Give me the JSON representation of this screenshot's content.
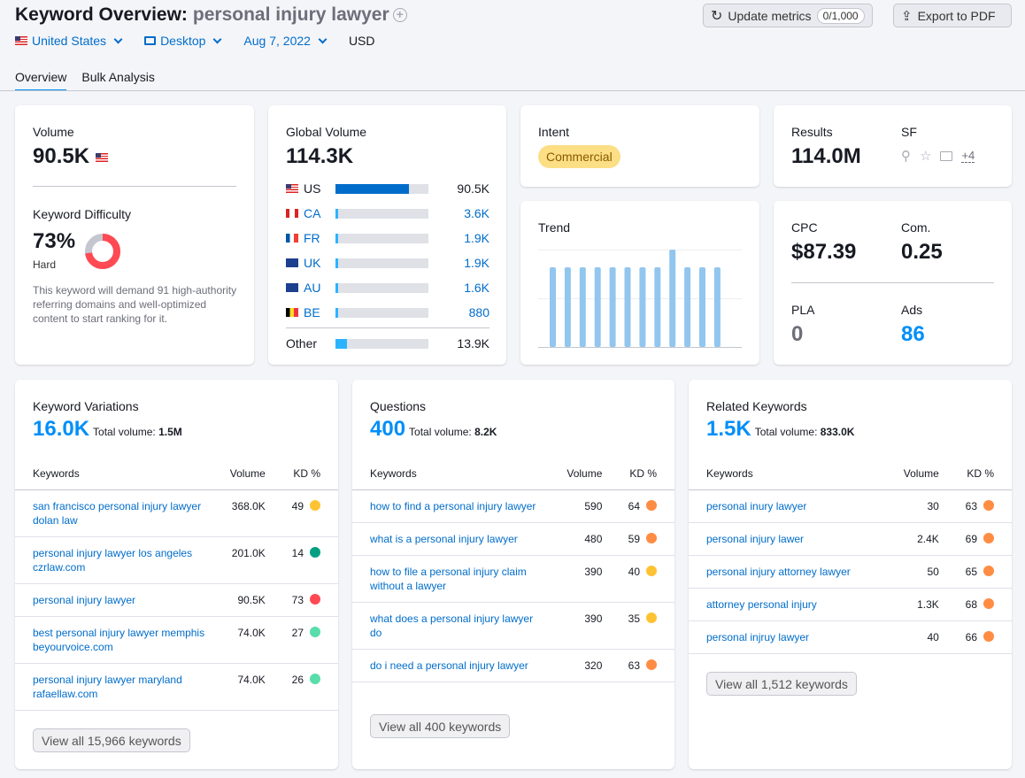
{
  "header": {
    "title": "Keyword Overview:",
    "keyword": "personal injury lawyer",
    "add_icon": "plus-circle-icon",
    "country": "United States",
    "device": "Desktop",
    "date": "Aug 7, 2022",
    "currency": "USD",
    "update_label": "Update metrics",
    "update_count": "0/1,000",
    "export_label": "Export to PDF"
  },
  "tabs": [
    {
      "label": "Overview",
      "active": true
    },
    {
      "label": "Bulk Analysis",
      "active": false
    }
  ],
  "volume": {
    "label": "Volume",
    "value": "90.5K"
  },
  "kd": {
    "label": "Keyword Difficulty",
    "value": "73%",
    "percent": 73,
    "level": "Hard",
    "description": "This keyword will demand 91 high-authority referring domains and well-optimized content to start ranking for it.",
    "color": "#ff4953"
  },
  "global_volume": {
    "label": "Global Volume",
    "value": "114.3K",
    "countries": [
      {
        "code": "US",
        "value": "90.5K",
        "share": 0.79
      },
      {
        "code": "CA",
        "value": "3.6K",
        "share": 0.03
      },
      {
        "code": "FR",
        "value": "1.9K",
        "share": 0.017
      },
      {
        "code": "UK",
        "value": "1.9K",
        "share": 0.017
      },
      {
        "code": "AU",
        "value": "1.6K",
        "share": 0.014
      },
      {
        "code": "BE",
        "value": "880",
        "share": 0.008
      }
    ],
    "other": {
      "label": "Other",
      "value": "13.9K",
      "share": 0.12
    }
  },
  "intent": {
    "label": "Intent",
    "value": "Commercial"
  },
  "results": {
    "label": "Results",
    "value": "114.0M",
    "sf_label": "SF",
    "sf_more": "+4",
    "sf_icons": [
      "location-pin-icon",
      "star-icon",
      "image-icon"
    ]
  },
  "trend": {
    "label": "Trend",
    "values": [
      74000,
      74000,
      74000,
      74000,
      74000,
      74000,
      74000,
      74000,
      90500,
      74000,
      74000,
      74000
    ]
  },
  "cpc": {
    "label": "CPC",
    "value": "$87.39"
  },
  "com": {
    "label": "Com.",
    "value": "0.25"
  },
  "pla": {
    "label": "PLA",
    "value": "0"
  },
  "ads": {
    "label": "Ads",
    "value": "86"
  },
  "panels": [
    {
      "title": "Keyword Variations",
      "count": "16.0K",
      "total_label": "Total volume:",
      "total": "1.5M",
      "cols": [
        "Keywords",
        "Volume",
        "KD %"
      ],
      "rows": [
        {
          "k": "san francisco personal injury lawyer dolan law",
          "v": "368.0K",
          "kd": "49",
          "c": "#ffc233"
        },
        {
          "k": "personal injury lawyer los angeles czrlaw.com",
          "v": "201.0K",
          "kd": "14",
          "c": "#009f81"
        },
        {
          "k": "personal injury lawyer",
          "v": "90.5K",
          "kd": "73",
          "c": "#ff4953"
        },
        {
          "k": "best personal injury lawyer memphis beyourvoice.com",
          "v": "74.0K",
          "kd": "27",
          "c": "#59ddaa"
        },
        {
          "k": "personal injury lawyer maryland rafaellaw.com",
          "v": "74.0K",
          "kd": "26",
          "c": "#59ddaa"
        }
      ],
      "view_all": "View all 15,966 keywords"
    },
    {
      "title": "Questions",
      "count": "400",
      "total_label": "Total volume:",
      "total": "8.2K",
      "cols": [
        "Keywords",
        "Volume",
        "KD %"
      ],
      "rows": [
        {
          "k": "how to find a personal injury lawyer",
          "v": "590",
          "kd": "64",
          "c": "#ff8c43"
        },
        {
          "k": "what is a personal injury lawyer",
          "v": "480",
          "kd": "59",
          "c": "#ff8c43"
        },
        {
          "k": "how to file a personal injury claim without a lawyer",
          "v": "390",
          "kd": "40",
          "c": "#ffc233"
        },
        {
          "k": "what does a personal injury lawyer do",
          "v": "390",
          "kd": "35",
          "c": "#ffc233"
        },
        {
          "k": "do i need a personal injury lawyer",
          "v": "320",
          "kd": "63",
          "c": "#ff8c43"
        }
      ],
      "view_all": "View all 400 keywords"
    },
    {
      "title": "Related Keywords",
      "count": "1.5K",
      "total_label": "Total volume:",
      "total": "833.0K",
      "cols": [
        "Keywords",
        "Volume",
        "KD %"
      ],
      "rows": [
        {
          "k": "personal inury lawyer",
          "v": "30",
          "kd": "63",
          "c": "#ff8c43"
        },
        {
          "k": "personal injury lawer",
          "v": "2.4K",
          "kd": "69",
          "c": "#ff8c43"
        },
        {
          "k": "personal injury attorney lawyer",
          "v": "50",
          "kd": "65",
          "c": "#ff8c43"
        },
        {
          "k": "attorney personal injury",
          "v": "1.3K",
          "kd": "68",
          "c": "#ff8c43"
        },
        {
          "k": "personal injruy lawyer",
          "v": "40",
          "kd": "66",
          "c": "#ff8c43"
        }
      ],
      "view_all": "View all 1,512 keywords"
    }
  ]
}
